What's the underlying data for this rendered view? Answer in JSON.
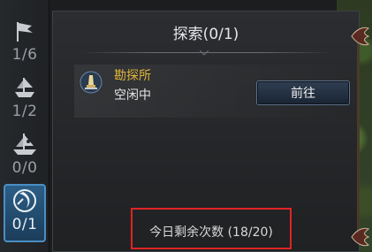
{
  "sidebar": {
    "items": [
      {
        "icon": "flag-icon",
        "count": "1/6",
        "active": false
      },
      {
        "icon": "ship-small-icon",
        "count": "1/2",
        "active": false
      },
      {
        "icon": "ship-pirate-icon",
        "count": "0/0",
        "active": false
      },
      {
        "icon": "compass-dragon-icon",
        "count": "0/1",
        "active": true
      }
    ]
  },
  "panel": {
    "title": "探索(0/1)",
    "location": {
      "name": "勘探所",
      "status": "空闲中",
      "icon": "beacon-icon"
    },
    "go_button": "前往",
    "remaining": "今日剩余次数 (18/20)"
  },
  "colors": {
    "accent_gold": "#e0b23a",
    "highlight_red": "#e02424",
    "active_blue": "#2c5e86"
  }
}
